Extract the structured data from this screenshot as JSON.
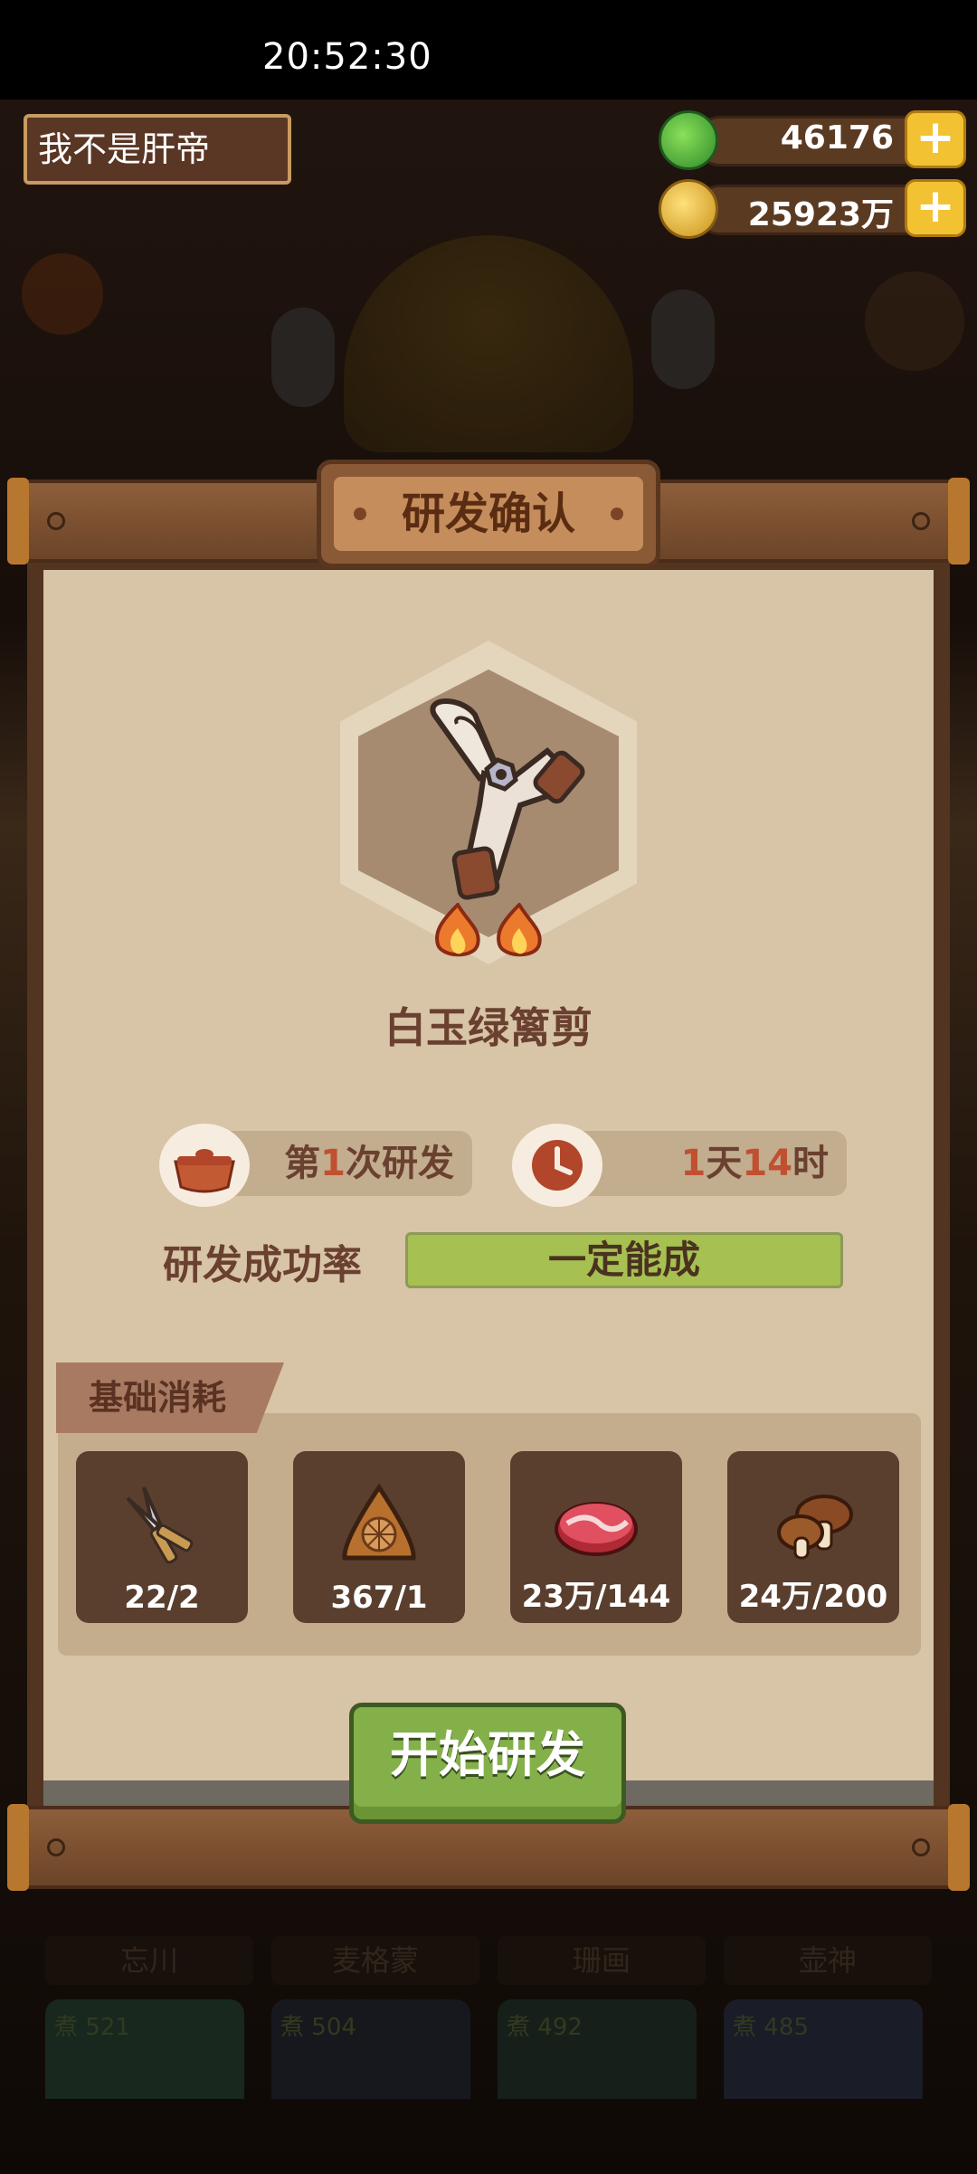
{
  "status_bar": {
    "time": "20:52:30"
  },
  "header": {
    "player_name": "我不是肝帝",
    "jade_amount": "46176",
    "coin_amount": "25923万",
    "plus_symbol": "+"
  },
  "background_cards": {
    "labels": [
      "忘川",
      "麦格蒙",
      "珊画",
      "壶神"
    ],
    "badge_char": "煮",
    "counts": [
      "521",
      "504",
      "492",
      "485"
    ]
  },
  "dialog": {
    "title": "研发确认",
    "item_name": "白玉绿篱剪",
    "research_count": {
      "prefix": "第",
      "number": "1",
      "suffix": "次研发"
    },
    "duration": {
      "days": "1",
      "days_unit": "天",
      "hours": "14",
      "hours_unit": "时"
    },
    "success_rate_label": "研发成功率",
    "success_rate_value": "一定能成",
    "cost_section_title": "基础消耗",
    "costs": [
      {
        "icon": "shears-icon",
        "count": "22/2"
      },
      {
        "icon": "dumpling-icon",
        "count": "367/1"
      },
      {
        "icon": "meat-icon",
        "count": "23万/144"
      },
      {
        "icon": "mushroom-icon",
        "count": "24万/200"
      }
    ],
    "start_button": "开始研发"
  },
  "colors": {
    "accent_green": "#84b04a",
    "rate_bar": "#a6c052",
    "highlight_red": "#c05030",
    "paper": "#d8c4a6",
    "brown_text": "#6a4030"
  }
}
